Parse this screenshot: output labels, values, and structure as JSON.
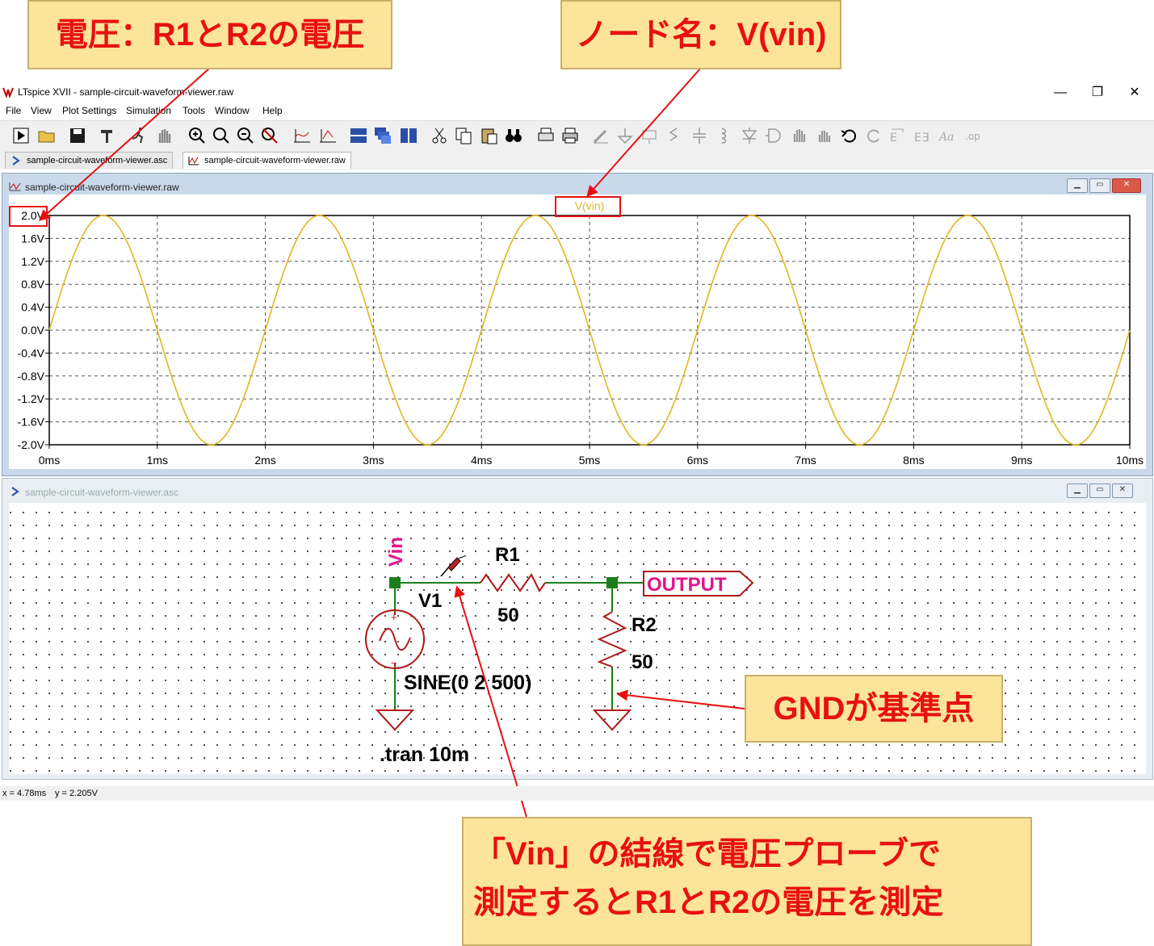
{
  "window": {
    "title": "LTspice XVII - sample-circuit-waveform-viewer.raw",
    "minimize": "—",
    "restore": "❐",
    "close": "✕"
  },
  "menu": [
    "File",
    "View",
    "Plot Settings",
    "Simulation",
    "Tools",
    "Window",
    "Help"
  ],
  "tabs": [
    {
      "label": "sample-circuit-waveform-viewer.asc"
    },
    {
      "label": "sample-circuit-waveform-viewer.raw"
    }
  ],
  "plot_window": {
    "title": "sample-circuit-waveform-viewer.raw"
  },
  "schematic_window": {
    "title": "sample-circuit-waveform-viewer.asc"
  },
  "chart_data": {
    "type": "line",
    "title": "V(vin)",
    "series": [
      {
        "name": "V(vin)",
        "color": "#e6b422",
        "function": "2*sin(2*pi*500*t)",
        "amplitude": 2,
        "frequency_hz": 500
      }
    ],
    "xlabel": "",
    "ylabel": "",
    "xlim": [
      0,
      10
    ],
    "ylim": [
      -2.0,
      2.0
    ],
    "x_ticks": [
      "0ms",
      "1ms",
      "2ms",
      "3ms",
      "4ms",
      "5ms",
      "6ms",
      "7ms",
      "8ms",
      "9ms",
      "10ms"
    ],
    "y_ticks": [
      "2.0V",
      "1.6V",
      "1.2V",
      "0.8V",
      "0.4V",
      "0.0V",
      "-0.4V",
      "-0.8V",
      "-1.2V",
      "-1.6V",
      "-2.0V"
    ],
    "grid": true
  },
  "schematic": {
    "net_vin": "Vin",
    "r1_name": "R1",
    "r1_value": "50",
    "r2_name": "R2",
    "r2_value": "50",
    "v1_name": "V1",
    "v1_value": "SINE(0 2 500)",
    "output_label": "OUTPUT",
    "directive": ".tran 10m",
    "plus": "+",
    "minus": "−"
  },
  "status": {
    "x": "x = 4.78ms",
    "y": "y = 2.205V"
  },
  "callouts": {
    "voltage": "電圧：R1とR2の電圧",
    "node": "ノード名：V(vin)",
    "gnd": "GNDが基準点",
    "probe_line1": "「Vin」の結線で電圧プローブで",
    "probe_line2": "測定するとR1とR2の電圧を測定"
  },
  "colors": {
    "trace": "#e6b422",
    "wire": "#1a7f1a",
    "component": "#b01818",
    "net_label": "#e0158a",
    "callout_bg": "#fce49a",
    "annot_red": "#e81010"
  }
}
